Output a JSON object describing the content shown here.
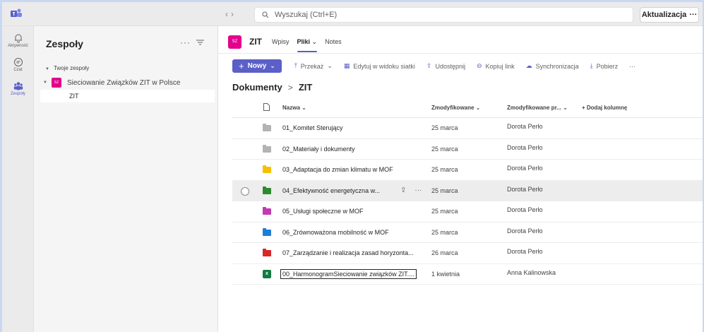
{
  "topbar": {
    "back_arrow": "‹",
    "forward_arrow": "›",
    "search_placeholder": "Wyszukaj (Ctrl+E)",
    "update_label": "Aktualizacja",
    "update_more": "···"
  },
  "rail": [
    {
      "label": "Aktywność",
      "icon": "bell-icon"
    },
    {
      "label": "Czat",
      "icon": "chat-icon"
    },
    {
      "label": "Zespoły",
      "icon": "teams-icon",
      "active": true
    }
  ],
  "teams_panel": {
    "title": "Zespoły",
    "more": "···",
    "section_label": "Twoje zespoły",
    "team_avatar": "SZ",
    "team_name": "Sieciowanie Związków ZIT w Polsce",
    "channel": "ZIT"
  },
  "main": {
    "team_avatar": "SZ",
    "team_name": "ZIT",
    "tabs": [
      {
        "label": "Wpisy"
      },
      {
        "label": "Pliki",
        "active": true,
        "dropdown": "⌄"
      },
      {
        "label": "Notes"
      }
    ]
  },
  "toolbar": {
    "new_label": "Nowy",
    "items": [
      {
        "label": "Przekaż",
        "icon": "⤒",
        "caret": "⌄"
      },
      {
        "label": "Edytuj w widoku siatki",
        "icon": "▦"
      },
      {
        "label": "Udostępnij",
        "icon": "⇪"
      },
      {
        "label": "Kopiuj link",
        "icon": "⊖"
      },
      {
        "label": "Synchronizacja",
        "icon": "☁"
      },
      {
        "label": "Pobierz",
        "icon": "⤓"
      },
      {
        "label": "···",
        "icon": ""
      }
    ]
  },
  "breadcrumb": {
    "root": "Dokumenty",
    "sep": ">",
    "current": "ZIT"
  },
  "table": {
    "headers": {
      "name": "Nazwa ⌄",
      "modified": "Zmodyfikowane ⌄",
      "modified_by": "Zmodyfikowane pr... ⌄",
      "add_column": "+ Dodaj kolumnę"
    },
    "row_actions_share": "⇪",
    "row_actions_more": "···",
    "rows": [
      {
        "name": "01_Komitet Sterujący",
        "modified": "25 marca",
        "by": "Dorota Perło",
        "type": "folder",
        "color": "#b3b3b3"
      },
      {
        "name": "02_Materiały i dokumenty",
        "modified": "25 marca",
        "by": "Dorota Perło",
        "type": "folder",
        "color": "#b3b3b3"
      },
      {
        "name": "03_Adaptacja do zmian klimatu w MOF",
        "modified": "25 marca",
        "by": "Dorota Perło",
        "type": "folder",
        "color": "#f5c000"
      },
      {
        "name": "04_Efektywność energetyczna w...",
        "modified": "25 marca",
        "by": "Dorota Perło",
        "type": "folder",
        "color": "#2d8a2d",
        "hover": true
      },
      {
        "name": "05_Usługi społeczne w MOF",
        "modified": "25 marca",
        "by": "Dorota Perło",
        "type": "folder",
        "color": "#c239b3"
      },
      {
        "name": "06_Zrównoważona mobilność w MOF",
        "modified": "25 marca",
        "by": "Dorota Perło",
        "type": "folder",
        "color": "#1b7fd4"
      },
      {
        "name": "07_Zarządzanie i realizacja zasad horyzonta...",
        "modified": "26 marca",
        "by": "Dorota Perło",
        "type": "folder",
        "color": "#d92626"
      },
      {
        "name": "00_HarmonogramSieciowanie związków ZIT....",
        "modified": "1 kwietnia",
        "by": "Anna Kalinowska",
        "type": "excel",
        "file_badge": "x",
        "selected": true
      }
    ]
  }
}
